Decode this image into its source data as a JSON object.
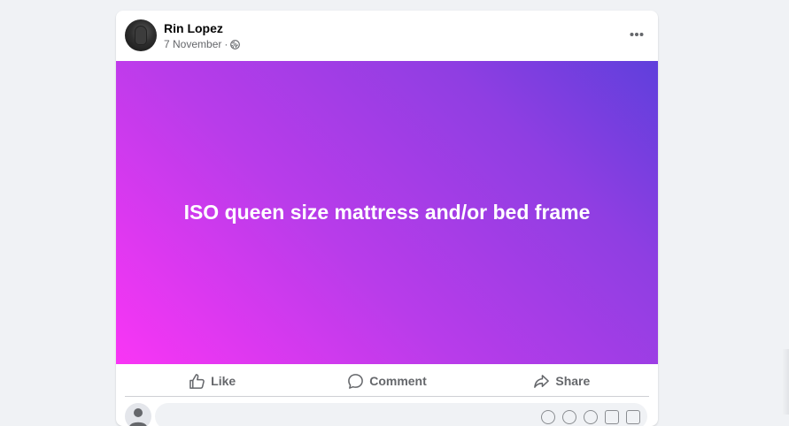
{
  "post": {
    "author": "Rin Lopez",
    "date": "7 November",
    "separator": "·",
    "privacy_icon": "globe-icon",
    "more_icon": "more-horizontal-icon",
    "banner_text": "ISO queen size mattress and/or bed frame",
    "banner_gradient": [
      "#f935f5",
      "#5f3fdc"
    ]
  },
  "actions": {
    "like_label": "Like",
    "comment_label": "Comment",
    "share_label": "Share"
  },
  "comment_box": {
    "placeholder": "",
    "tools": [
      "sticker-icon",
      "emoji-icon",
      "camera-icon",
      "gif-icon",
      "sticker-square-icon"
    ]
  },
  "colors": {
    "page_bg": "#f0f2f5",
    "card_bg": "#ffffff",
    "text_primary": "#050505",
    "text_secondary": "#65676b"
  }
}
